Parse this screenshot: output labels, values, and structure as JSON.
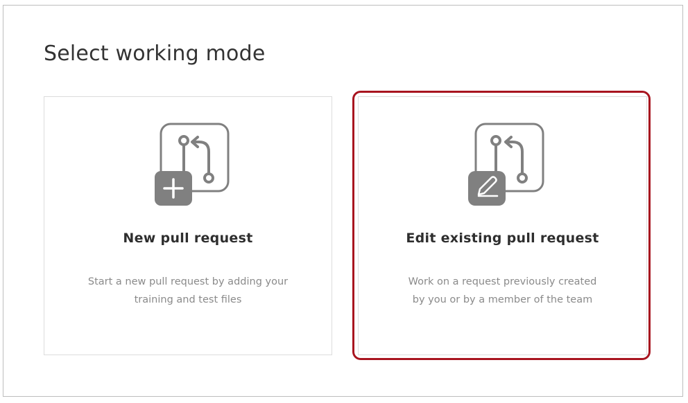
{
  "page": {
    "title": "Select working mode"
  },
  "cards": [
    {
      "id": "new",
      "title": "New pull request",
      "description_lines": [
        "Start a new pull request by adding your",
        "training and test files"
      ],
      "icon": "new-pull-request-icon",
      "selected": false
    },
    {
      "id": "edit",
      "title": "Edit existing pull request",
      "description_lines": [
        "Work on a request previously created",
        "by you or by a member of the team"
      ],
      "icon": "edit-pull-request-icon",
      "selected": true
    }
  ],
  "colors": {
    "icon_gray": "#808080",
    "selected_outline": "#a8141f",
    "title_text": "#2e2e2e",
    "desc_text": "#8a8a8a"
  }
}
